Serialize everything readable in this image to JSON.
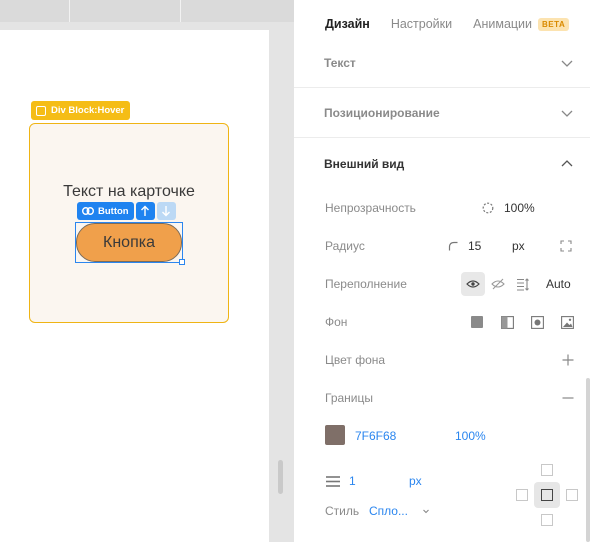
{
  "canvas": {
    "hover_tag": "Div Block:Hover",
    "card_text": "Текст на карточке",
    "selected_tag": "Button",
    "button_text": "Кнопка"
  },
  "panel": {
    "tabs": [
      {
        "label": "Дизайн",
        "active": true
      },
      {
        "label": "Настройки",
        "active": false
      },
      {
        "label": "Анимации",
        "active": false
      }
    ],
    "beta_badge": "BETA",
    "sections": {
      "text": "Текст",
      "positioning": "Позиционирование",
      "appearance": "Внешний вид"
    },
    "opacity": {
      "label": "Непрозрачность",
      "value": "100%"
    },
    "radius": {
      "label": "Радиус",
      "value": "15",
      "unit": "px"
    },
    "overflow": {
      "label": "Переполнение",
      "selected": "visible",
      "auto_label": "Auto"
    },
    "background": {
      "label": "Фон"
    },
    "background_color": {
      "label": "Цвет фона"
    },
    "borders": {
      "label": "Границы",
      "color_hex": "7F6F68",
      "color_swatch": "#7F6F68",
      "opacity": "100%",
      "width": "1",
      "width_unit": "px",
      "style_label": "Стиль",
      "style_value": "Спло..."
    }
  },
  "colors": {
    "accent_blue": "#1f83f0",
    "hover_yellow": "#f5bd16",
    "button_orange": "#f0a04b",
    "card_bg": "#fbf6f0"
  }
}
